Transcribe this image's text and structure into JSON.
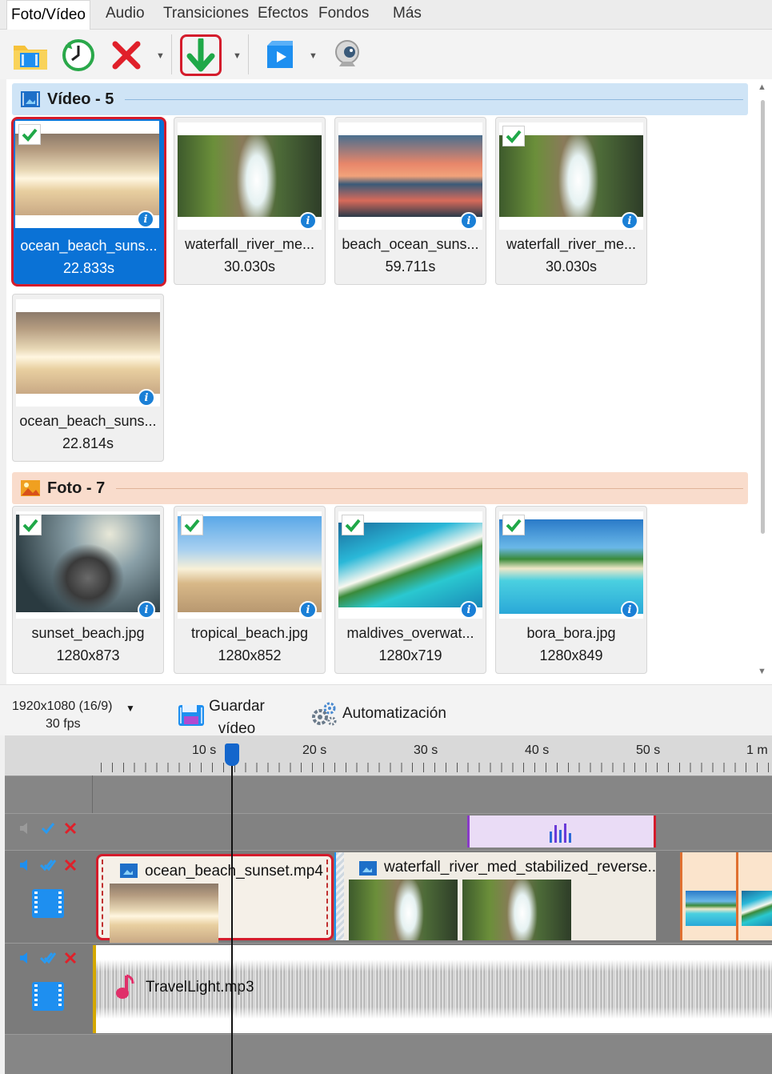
{
  "tabs": [
    "Foto/Vídeo",
    "Audio",
    "Transiciones",
    "Efectos",
    "Fondos",
    "Más"
  ],
  "toolbar": {
    "buttons": [
      "add-media",
      "clock",
      "delete",
      "download",
      "preview",
      "webcam"
    ]
  },
  "video_group": {
    "title": "Vídeo - 5",
    "items": [
      {
        "name": "ocean_beach_suns...",
        "meta": "22.833s",
        "checked": true,
        "selected": true
      },
      {
        "name": "waterfall_river_me...",
        "meta": "30.030s",
        "checked": false
      },
      {
        "name": "beach_ocean_suns...",
        "meta": "59.711s",
        "checked": false
      },
      {
        "name": "waterfall_river_me...",
        "meta": "30.030s",
        "checked": true
      },
      {
        "name": "ocean_beach_suns...",
        "meta": "22.814s",
        "checked": false
      }
    ]
  },
  "photo_group": {
    "title": "Foto - 7",
    "items": [
      {
        "name": "sunset_beach.jpg",
        "meta": "1280x873",
        "checked": true
      },
      {
        "name": "tropical_beach.jpg",
        "meta": "1280x852",
        "checked": true
      },
      {
        "name": "maldives_overwat...",
        "meta": "1280x719",
        "checked": true
      },
      {
        "name": "bora_bora.jpg",
        "meta": "1280x849",
        "checked": true
      }
    ]
  },
  "bottom": {
    "resolution": "1920x1080 (16/9)",
    "fps": "30 fps",
    "save_label_1": "Guardar",
    "save_label_2": "vídeo",
    "automation_label": "Automatización"
  },
  "timeline": {
    "ruler_labels": [
      "10 s",
      "20 s",
      "30 s",
      "40 s",
      "50 s",
      "1 m"
    ],
    "clips": {
      "main": "ocean_beach_sunset.mp4",
      "second": "waterfall_river_med_stabilized_reverse..."
    },
    "audio_track": "TravelLight.mp3"
  },
  "colors": {
    "accent": "#0a72d6",
    "highlight": "#d41c2c",
    "video_header": "#cfe4f6",
    "photo_header": "#f9dccc"
  }
}
